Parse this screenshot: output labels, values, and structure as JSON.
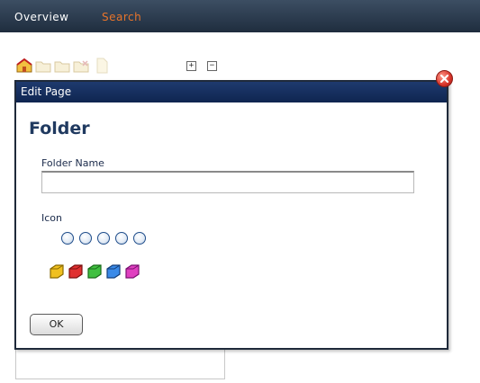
{
  "nav": {
    "tabs": [
      {
        "label": "Overview"
      },
      {
        "label": "Search"
      }
    ]
  },
  "toolbar": {
    "expand_glyph": "+",
    "collapse_glyph": "−",
    "icons": [
      "home-folder-icon",
      "folder-icon",
      "folder-icon",
      "folder-icon",
      "page-icon"
    ]
  },
  "dialog": {
    "title": "Edit Page",
    "heading": "Folder",
    "folder_name_label": "Folder Name",
    "folder_name_value": "",
    "icon_label": "Icon",
    "icon_options": [
      {
        "icon": "yellow-folder-icon",
        "color": "#f0c020"
      },
      {
        "icon": "red-folder-icon",
        "color": "#e03030"
      },
      {
        "icon": "green-folder-icon",
        "color": "#40c040"
      },
      {
        "icon": "blue-folder-icon",
        "color": "#3a8ae8"
      },
      {
        "icon": "magenta-folder-icon",
        "color": "#e040c0"
      }
    ],
    "ok_label": "OK"
  },
  "colors": {
    "nav_bg": "#2c3b4e",
    "nav_active": "#e8742a",
    "dialog_title_bg": "#142d5c",
    "heading": "#203a60"
  }
}
